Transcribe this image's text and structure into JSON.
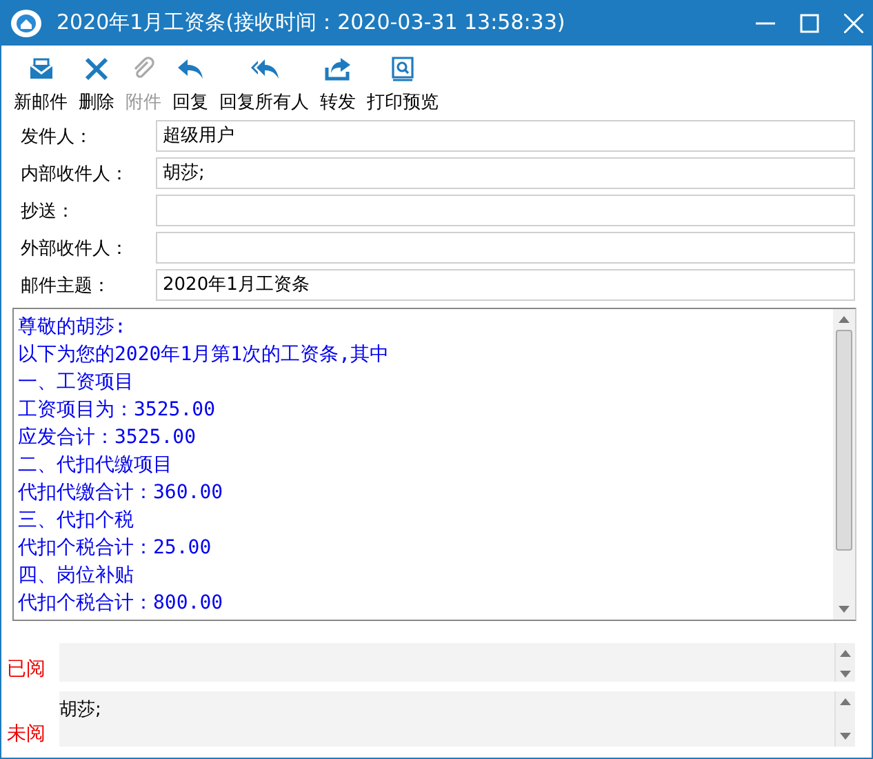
{
  "window": {
    "title": "2020年1月工资条(接收时间：2020-03-31 13:58:33)"
  },
  "toolbar": [
    {
      "kind": "new",
      "label": "新邮件",
      "disabled": false
    },
    {
      "kind": "delete",
      "label": "删除",
      "disabled": false
    },
    {
      "kind": "attach",
      "label": "附件",
      "disabled": true
    },
    {
      "kind": "reply",
      "label": "回复",
      "disabled": false
    },
    {
      "kind": "replyall",
      "label": "回复所有人",
      "disabled": false
    },
    {
      "kind": "forward",
      "label": "转发",
      "disabled": false
    },
    {
      "kind": "print",
      "label": "打印预览",
      "disabled": false
    }
  ],
  "fields": [
    {
      "label": "发件人：",
      "value": "超级用户"
    },
    {
      "label": "内部收件人：",
      "value": "胡莎;"
    },
    {
      "label": "抄送："
    },
    {
      "label": "外部收件人："
    },
    {
      "label": "邮件主题：",
      "value": "2020年1月工资条"
    }
  ],
  "body": {
    "lines": [
      "尊敬的胡莎:",
      "以下为您的2020年1月第1次的工资条,其中",
      "一、工资项目",
      "工资项目为：3525.00",
      "应发合计：3525.00",
      "二、代扣代缴项目",
      "代扣代缴合计：360.00",
      "三、代扣个税",
      "代扣个税合计：25.00",
      "四、岗位补贴",
      "代扣个税合计：800.00"
    ]
  },
  "status": [
    {
      "label": "已阅"
    },
    {
      "label": "未阅",
      "value": "胡莎;"
    }
  ]
}
